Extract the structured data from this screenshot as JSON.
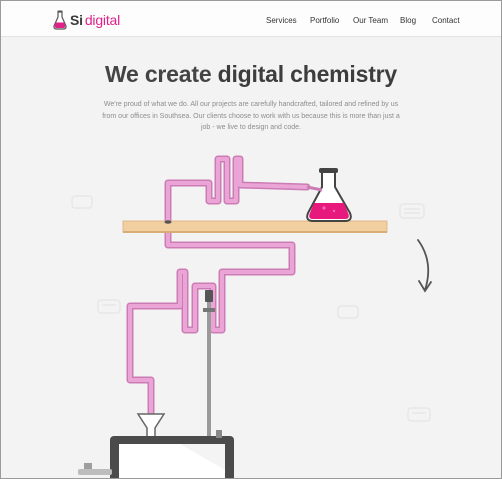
{
  "brand": {
    "name_bold": "Si",
    "name_light": "digital",
    "accent_color": "#e0218a",
    "logo_icon": "flask-icon"
  },
  "nav": {
    "items": [
      {
        "label": "Services"
      },
      {
        "label": "Portfolio"
      },
      {
        "label": "Our Team"
      },
      {
        "label": "Blog"
      },
      {
        "label": "Contact"
      }
    ]
  },
  "hero": {
    "headline_light": "We create ",
    "headline_bold": "digital chemistry",
    "intro": "We're proud of what we do. All our projects are carefully handcrafted, tailored and refined by us from our offices in Southsea. Our clients choose to work with us because this is more than just a job - we live to design and code."
  },
  "illustration": {
    "shelf_color": "#f2cfa0",
    "tube_color": "#e89ad0",
    "liquid_color": "#e8197c",
    "arrow_icon": "curved-arrow-down-icon",
    "objects": [
      "flask-icon",
      "shelf",
      "tube",
      "funnel-icon",
      "stand-rod",
      "monitor"
    ]
  }
}
